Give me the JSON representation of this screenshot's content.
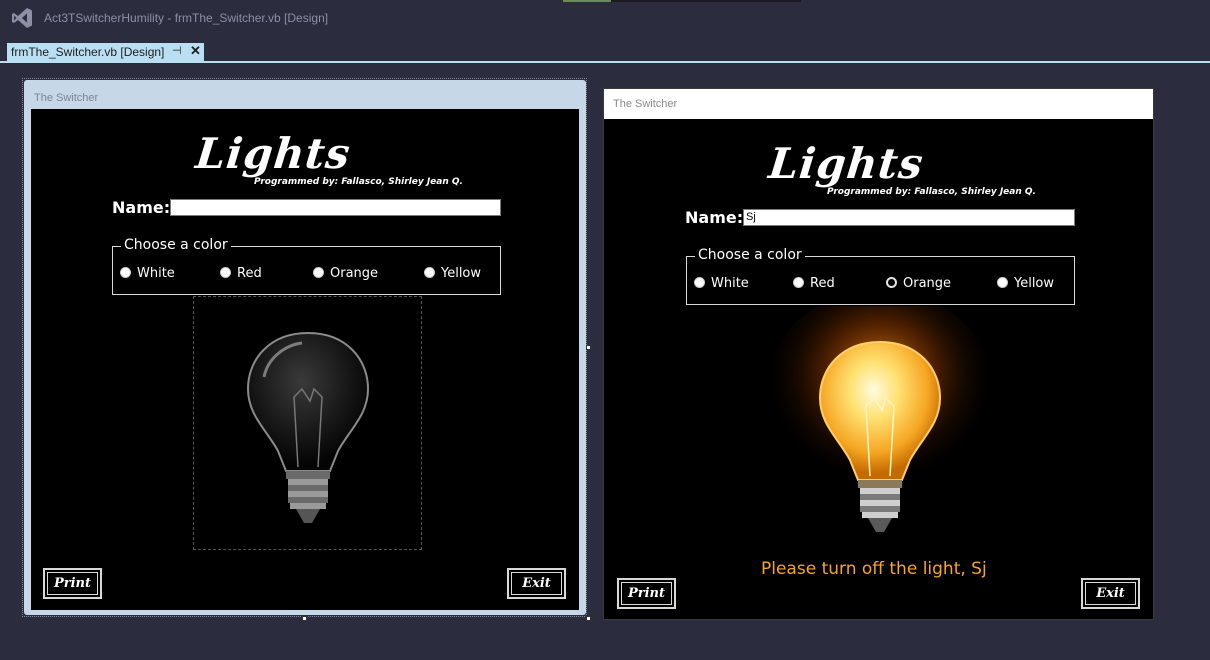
{
  "ide": {
    "title": "Act3TSwitcherHumility - frmThe_Switcher.vb [Design]",
    "tab_label": "frmThe_Switcher.vb [Design]",
    "tab_pin": "⊣",
    "tab_close": "✕"
  },
  "designer": {
    "window_title": "The Switcher",
    "logo": "Lights",
    "byline": "Programmed by: Fallasco, Shirley Jean Q.",
    "name_label": "Name:",
    "name_value": "",
    "group_label": "Choose a color",
    "colors": [
      "White",
      "Red",
      "Orange",
      "Yellow"
    ],
    "print_label": "Print",
    "exit_label": "Exit"
  },
  "runtime": {
    "window_title": "The Switcher",
    "logo": "Lights",
    "byline": "Programmed by: Fallasco, Shirley Jean Q.",
    "name_label": "Name:",
    "name_value": "Sj",
    "group_label": "Choose a color",
    "colors": [
      "White",
      "Red",
      "Orange",
      "Yellow"
    ],
    "selected_color": "Orange",
    "message": "Please turn off the light, Sj",
    "print_label": "Print",
    "exit_label": "Exit"
  },
  "colors": {
    "ide_bg": "#2c2c3f",
    "tab_active": "#bbdff2",
    "message": "#f5a623",
    "form_bg": "#000000"
  }
}
